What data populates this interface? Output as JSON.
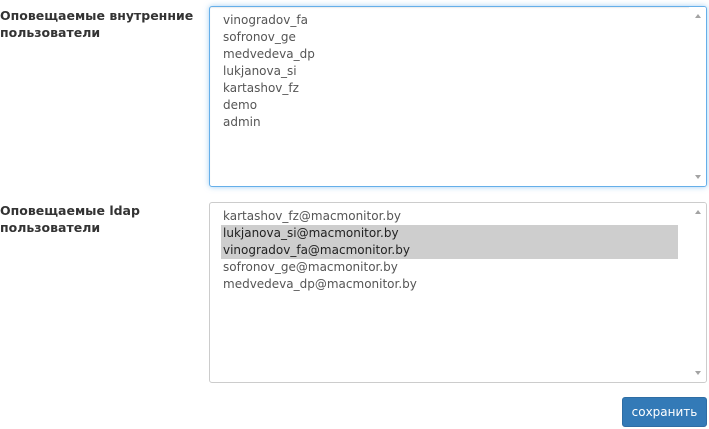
{
  "internal_users": {
    "label": "Оповещаемые внутренние пользователи",
    "options": [
      {
        "text": "vinogradov_fa",
        "selected": false
      },
      {
        "text": "sofronov_ge",
        "selected": false
      },
      {
        "text": "medvedeva_dp",
        "selected": false
      },
      {
        "text": "lukjanova_si",
        "selected": false
      },
      {
        "text": "kartashov_fz",
        "selected": false
      },
      {
        "text": "demo",
        "selected": false
      },
      {
        "text": "admin",
        "selected": false
      }
    ]
  },
  "ldap_users": {
    "label": "Оповещаемые ldap пользователи",
    "options": [
      {
        "text": "kartashov_fz@macmonitor.by",
        "selected": false
      },
      {
        "text": "lukjanova_si@macmonitor.by",
        "selected": true
      },
      {
        "text": "vinogradov_fa@macmonitor.by",
        "selected": true
      },
      {
        "text": "sofronov_ge@macmonitor.by",
        "selected": false
      },
      {
        "text": "medvedeva_dp@macmonitor.by",
        "selected": false
      }
    ]
  },
  "actions": {
    "save_label": "сохранить"
  },
  "colors": {
    "accent": "#337ab7",
    "focus_border": "#66afe9",
    "selected_bg": "#cecece"
  },
  "icons": {
    "scroll_up": "arrow-up-icon",
    "scroll_down": "arrow-down-icon"
  }
}
